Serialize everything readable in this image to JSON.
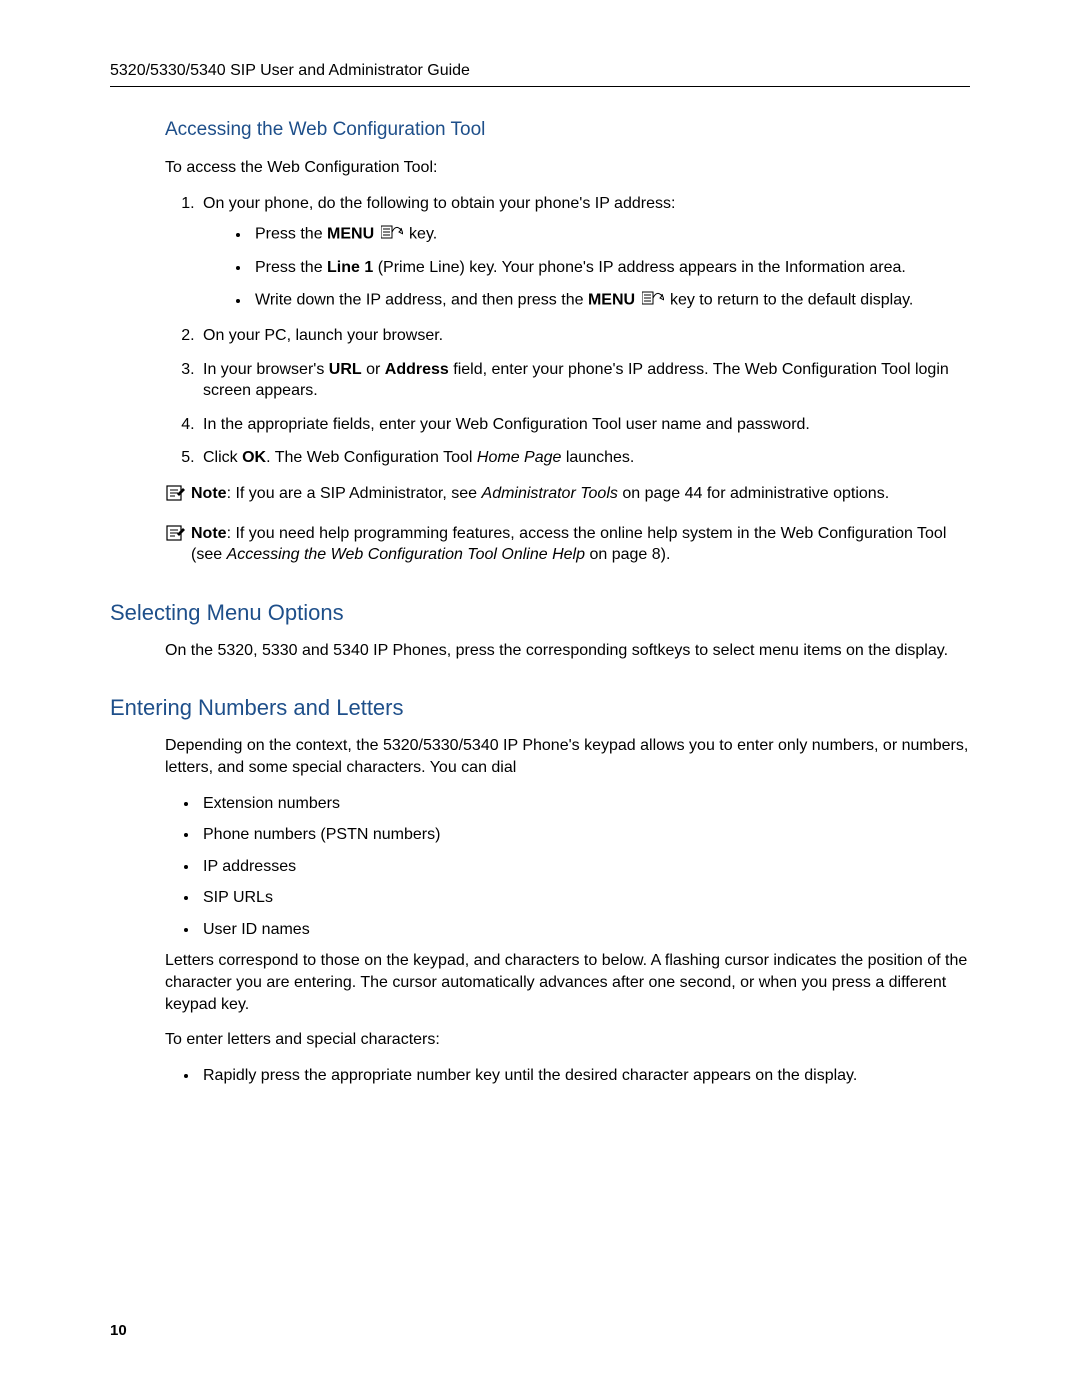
{
  "header": {
    "running_title": "5320/5330/5340 SIP User and Administrator Guide"
  },
  "section_web": {
    "heading": "Accessing the Web Configuration Tool",
    "intro": "To access the Web Configuration Tool:",
    "step1_lead": "On your phone, do the following to obtain your phone's IP address:",
    "step1_b1_a": "Press the ",
    "step1_b1_menu": "MENU",
    "step1_b1_b": " key.",
    "step1_b2_a": "Press the ",
    "step1_b2_line1": "Line 1",
    "step1_b2_b": " (Prime Line) key. Your phone's IP address appears in the Information area.",
    "step1_b3_a": "Write down the IP address, and then press the ",
    "step1_b3_menu": "MENU",
    "step1_b3_b": " key to return to the default display.",
    "step2": "On your PC, launch your browser.",
    "step3_a": "In your browser's ",
    "step3_url": "URL",
    "step3_or": " or ",
    "step3_addr": "Address",
    "step3_b": " field, enter your phone's IP address. The Web Configuration Tool login screen appears.",
    "step4": "In the appropriate fields, enter your Web Configuration Tool user name and password.",
    "step5_a": "Click ",
    "step5_ok": "OK",
    "step5_b": ". The Web Configuration Tool ",
    "step5_home": "Home Page",
    "step5_c": " launches.",
    "note1_label": "Note",
    "note1_a": ":  If you are a SIP Administrator, see ",
    "note1_em": "Administrator Tools",
    "note1_b": " on page 44 for administrative options.",
    "note2_label": "Note",
    "note2_a": ":  If you need help programming features, access the online help system in the Web Configuration Tool (see ",
    "note2_em": "Accessing the Web Configuration Tool Online Help",
    "note2_b": " on page 8)."
  },
  "section_menu": {
    "heading": "Selecting Menu Options",
    "para": "On the 5320, 5330 and 5340 IP Phones, press the corresponding softkeys to select menu items on the display."
  },
  "section_entry": {
    "heading": "Entering Numbers and Letters",
    "intro": "Depending on the context, the 5320/5330/5340 IP Phone's keypad allows you to enter only numbers, or numbers, letters, and some special characters. You can dial",
    "items": [
      "Extension numbers",
      "Phone numbers (PSTN numbers)",
      "IP addresses",
      "SIP URLs",
      "User ID names"
    ],
    "para2": "Letters correspond to those on the keypad, and characters to  below. A flashing cursor indicates the position of the character you are entering. The cursor automatically advances after one second, or when you press a different keypad key.",
    "para3": "To enter letters and special characters:",
    "bul1": "Rapidly press the appropriate number key until the desired character appears on the display."
  },
  "page_number": "10"
}
